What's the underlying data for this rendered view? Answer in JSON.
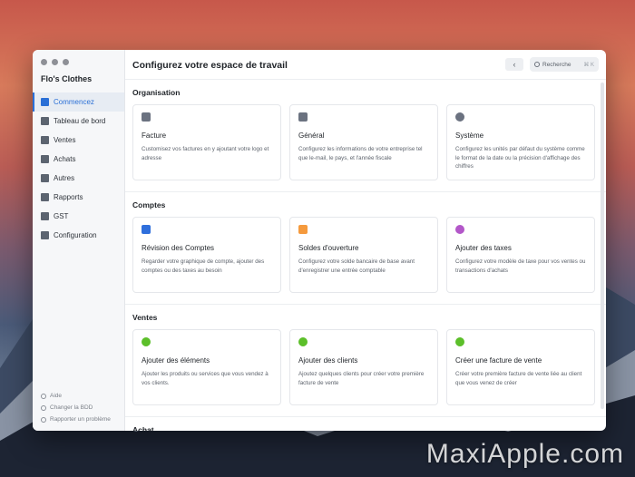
{
  "window": {
    "company_name": "Flo's Clothes",
    "title": "Configurez votre espace de travail"
  },
  "sidebar": {
    "items": [
      {
        "label": "Commencez",
        "icon": "wand-icon",
        "active": true
      },
      {
        "label": "Tableau de bord",
        "icon": "dashboard-icon"
      },
      {
        "label": "Ventes",
        "icon": "sales-icon"
      },
      {
        "label": "Achats",
        "icon": "purchases-icon"
      },
      {
        "label": "Autres",
        "icon": "others-icon"
      },
      {
        "label": "Rapports",
        "icon": "reports-icon"
      },
      {
        "label": "GST",
        "icon": "gst-icon"
      },
      {
        "label": "Configuration",
        "icon": "settings-icon"
      }
    ],
    "bottom_links": [
      {
        "label": "Aide",
        "icon": "help-icon"
      },
      {
        "label": "Changer la BDD",
        "icon": "database-icon"
      },
      {
        "label": "Rapporter un problème",
        "icon": "flag-icon"
      }
    ]
  },
  "header": {
    "back_label": "‹",
    "search_placeholder": "Recherche",
    "search_shortcut": "⌘ K"
  },
  "sections": [
    {
      "title": "Organisation",
      "cards": [
        {
          "title": "Facture",
          "desc": "Customisez vos factures en y ajoutant votre logo et adresse",
          "icon_color": "#6b7280"
        },
        {
          "title": "Général",
          "desc": "Configurez les informations de votre entreprise tel que le-mail, le pays, et l'année fiscale",
          "icon_color": "#6b7280"
        },
        {
          "title": "Système",
          "desc": "Configurez les unités par défaut du système comme le format de la date ou la précision d'affichage des chiffres",
          "icon_color": "#6b7280"
        }
      ]
    },
    {
      "title": "Comptes",
      "cards": [
        {
          "title": "Révision des Comptes",
          "desc": "Regarder votre graphique de compte, ajouter des comptes ou des taxes au besoin",
          "icon_color": "#2f6fdc"
        },
        {
          "title": "Soldes d'ouverture",
          "desc": "Configurez votre solde bancaire de base avant d'enregistrer une entrée comptable",
          "icon_color": "#f59a3d"
        },
        {
          "title": "Ajouter des taxes",
          "desc": "Configurez votre modèle de taxe pour vos ventes ou transactions d'achats",
          "icon_color": "#b357c9"
        }
      ]
    },
    {
      "title": "Ventes",
      "cards": [
        {
          "title": "Ajouter des éléments",
          "desc": "Ajouter les produits ou services que vous vendez à vos clients.",
          "icon_color": "#5cbf2a"
        },
        {
          "title": "Ajouter des clients",
          "desc": "Ajoutez quelques clients pour créer votre première facture de vente",
          "icon_color": "#5cbf2a"
        },
        {
          "title": "Créer une facture de vente",
          "desc": "Créer votre première facture de vente liée au client que vous venez de créer",
          "icon_color": "#5cbf2a"
        }
      ]
    },
    {
      "title": "Achat",
      "cards": []
    }
  ],
  "watermark": "MaxiApple.com"
}
